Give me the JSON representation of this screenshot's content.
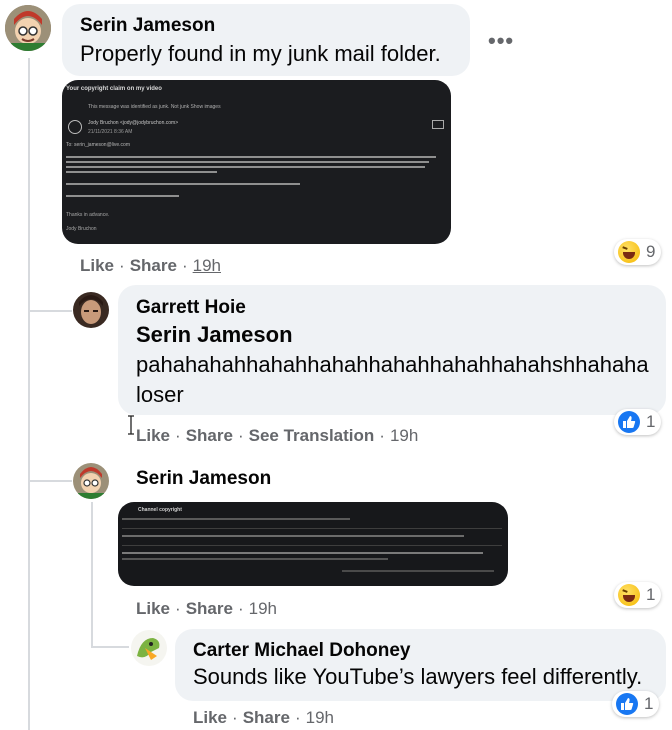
{
  "comments": [
    {
      "author": "Serin Jameson",
      "text": "Properly found in my junk mail folder.",
      "actions": {
        "like": "Like",
        "share": "Share",
        "time": "19h"
      },
      "reaction": {
        "type": "haha",
        "count": "9"
      },
      "attachment": {
        "heading": "Your copyright claim on my video",
        "junk_note": "This message was identified as junk.  Not junk  Show images",
        "sender": "Jody Bruchon <jody@jodybruchon.com>",
        "date": "21/11/2021 8:36 AM",
        "to": "To: serin_jameson@live.com",
        "closing": "Thanks in advance.",
        "signature": "Jody Bruchon"
      }
    },
    {
      "author": "Garrett Hoie",
      "mention": "Serin Jameson",
      "text_line1": "pahahahahhahahhahahhahahhahahhahahshhahaha",
      "text_line2": "loser",
      "actions": {
        "like": "Like",
        "share": "Share",
        "translate": "See Translation",
        "time": "19h"
      },
      "reaction": {
        "type": "like",
        "count": "1"
      }
    },
    {
      "author": "Serin Jameson",
      "actions": {
        "like": "Like",
        "share": "Share",
        "time": "19h"
      },
      "reaction": {
        "type": "haha",
        "count": "1"
      },
      "attachment": {
        "heading": "Channel copyright"
      }
    },
    {
      "author": "Carter Michael Dohoney",
      "text": "Sounds like YouTube’s lawyers feel differently.",
      "actions": {
        "like": "Like",
        "share": "Share",
        "time": "19h"
      },
      "reaction": {
        "type": "like",
        "count": "1"
      }
    }
  ],
  "more_icon": "•••",
  "colors": {
    "bubble": "#eff2f5",
    "meta": "#65676b",
    "like_blue": "#1877f2",
    "haha_yellow": "#f5b800"
  }
}
